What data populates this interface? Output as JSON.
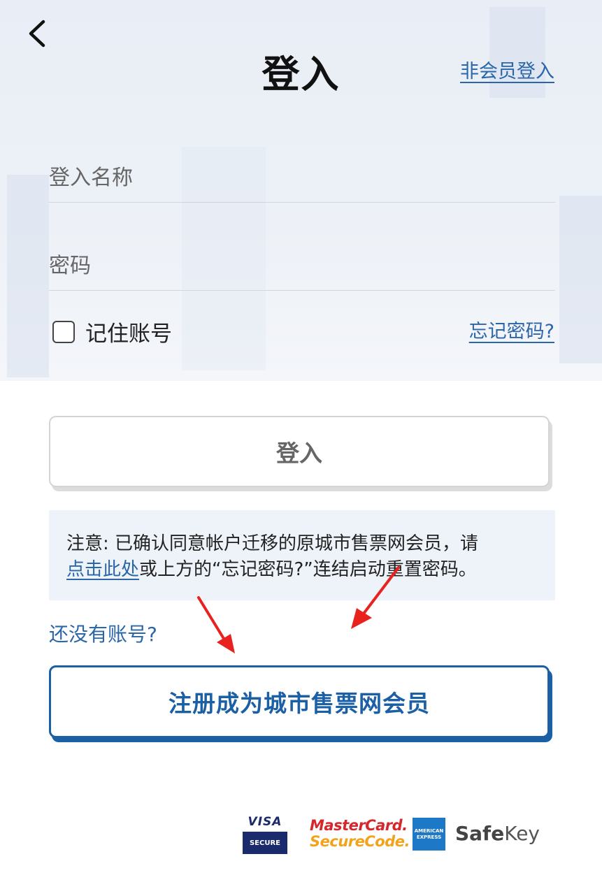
{
  "header": {
    "title": "登入",
    "guest_login": "非会员登入"
  },
  "form": {
    "username_placeholder": "登入名称",
    "password_placeholder": "密码",
    "remember_label": "记住账号",
    "forgot_link": "忘记密码?",
    "login_button": "登入"
  },
  "notice": {
    "prefix": "注意: 已确认同意帐户迁移的原城市售票网会员，请",
    "link": "点击此处",
    "suffix": "或上方的“忘记密码?”连结启动重置密码。"
  },
  "register": {
    "question": "还没有账号?",
    "button": "注册成为城市售票网会员"
  },
  "payment_logos": {
    "visa_top": "VISA",
    "visa_bottom": "SECURE",
    "mastercard_line1": "MasterCard.",
    "mastercard_line2": "SecureCode.",
    "amex_line1": "AMERICAN",
    "amex_line2": "EXPRESS",
    "safekey_bold": "Safe",
    "safekey_rest": "Key"
  },
  "colors": {
    "link_blue": "#2a66a8",
    "brand_blue": "#1b5fa5",
    "annotation_red": "#e8231f"
  }
}
